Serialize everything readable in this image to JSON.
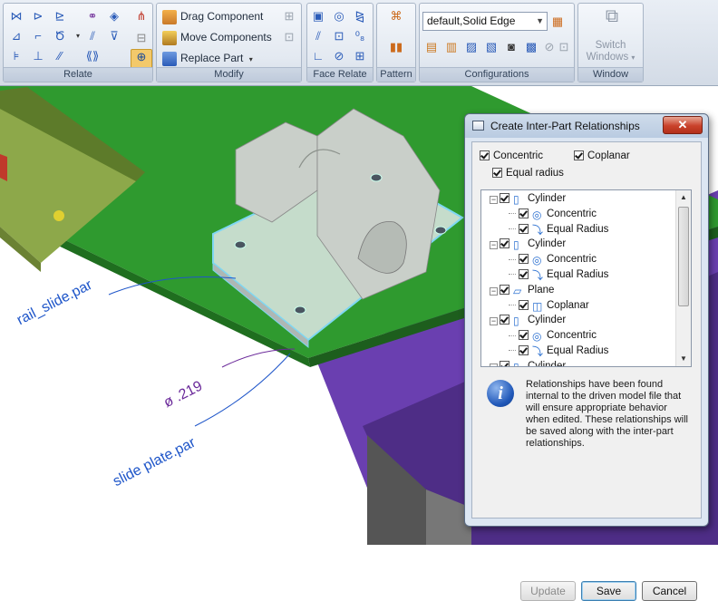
{
  "ribbon": {
    "groups": {
      "relate": "Relate",
      "modify": "Modify",
      "face_relate": "Face Relate",
      "pattern": "Pattern",
      "configurations": "Configurations",
      "window": "Window"
    },
    "modify": {
      "drag_component": "Drag Component",
      "move_components": "Move Components",
      "replace_part": "Replace Part"
    },
    "configurations": {
      "selected": "default,Solid Edge"
    },
    "window": {
      "switch_windows_1": "Switch",
      "switch_windows_2": "Windows"
    }
  },
  "viewport": {
    "labels": {
      "rail_slide": "rail_slide.par",
      "diameter": "ø .219",
      "slide_plate": "slide plate.par"
    },
    "colors": {
      "plate_green": "#2f9a2f",
      "purple": "#6a3fb0",
      "part_gray": "#c9cfc9",
      "label_blue": "#1f56c9",
      "dim_purple": "#6b2a9a"
    }
  },
  "dialog": {
    "title": "Create Inter-Part Relationships",
    "close": "✕",
    "options": {
      "concentric": "Concentric",
      "coplanar": "Coplanar",
      "equal_radius": "Equal radius"
    },
    "tree": [
      {
        "label": "Cylinder",
        "kind": "cylinder"
      },
      {
        "label": "Concentric",
        "kind": "concentric"
      },
      {
        "label": "Equal Radius",
        "kind": "equal-radius"
      },
      {
        "label": "Cylinder",
        "kind": "cylinder"
      },
      {
        "label": "Concentric",
        "kind": "concentric"
      },
      {
        "label": "Equal Radius",
        "kind": "equal-radius"
      },
      {
        "label": "Plane",
        "kind": "plane"
      },
      {
        "label": "Coplanar",
        "kind": "coplanar"
      },
      {
        "label": "Cylinder",
        "kind": "cylinder"
      },
      {
        "label": "Concentric",
        "kind": "concentric"
      },
      {
        "label": "Equal Radius",
        "kind": "equal-radius"
      },
      {
        "label": "Cylinder",
        "kind": "cylinder"
      }
    ],
    "info_icon": "i",
    "info_text": "Relationships have been found internal to the driven model file that will ensure appropriate behavior when edited. These relationships will be saved along with the inter-part relationships.",
    "buttons": {
      "update": "Update",
      "save": "Save",
      "cancel": "Cancel"
    }
  }
}
